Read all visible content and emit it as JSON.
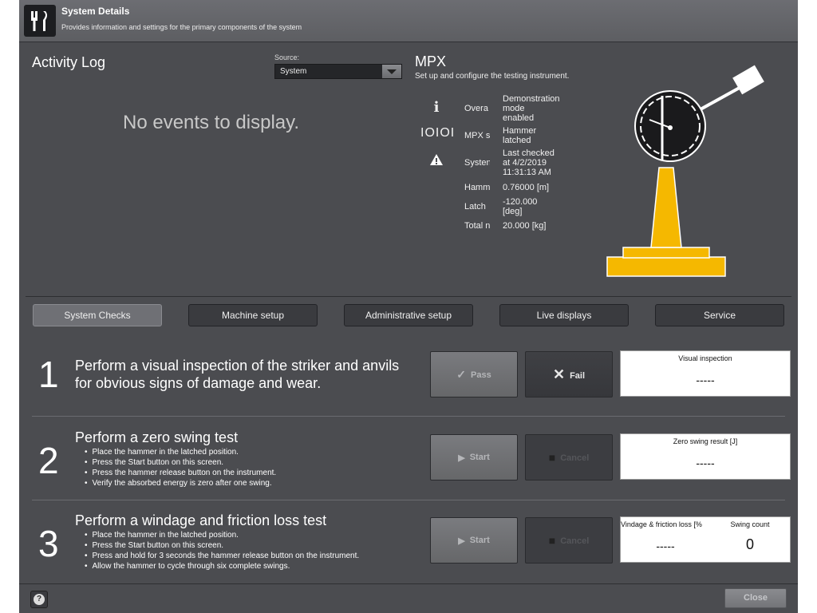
{
  "header": {
    "title": "System Details",
    "subtitle": "Provides information and settings for the primary components of the system"
  },
  "activity_log": {
    "title": "Activity Log",
    "source_label": "Source:",
    "source_value": "System",
    "empty_message": "No events to display."
  },
  "mpx": {
    "title": "MPX",
    "subtitle": "Set up and configure the testing instrument.",
    "rows": [
      {
        "label": "Overa",
        "value": "Demonstration mode enabled"
      },
      {
        "label": "MPX s",
        "value": "Hammer latched"
      },
      {
        "label": "Systen",
        "value": "Last checked at 4/2/2019 11:31:13 AM"
      },
      {
        "label": "Hamm",
        "value": "0.76000 [m]"
      },
      {
        "label": "Latch",
        "value": "-120.000 [deg]"
      },
      {
        "label": "Total n",
        "value": "20.000 [kg]"
      }
    ],
    "icons": {
      "overall": "i",
      "mpx_status": "IOIOI",
      "system": "!"
    },
    "colors": {
      "machine": "#f5b800"
    }
  },
  "tabs": [
    {
      "label": "System Checks",
      "active": true
    },
    {
      "label": "Machine setup"
    },
    {
      "label": "Administrative setup"
    },
    {
      "label": "Live displays"
    },
    {
      "label": "Service"
    }
  ],
  "steps": [
    {
      "number": "1",
      "title": "Perform a visual inspection of the striker and anvils for obvious signs of damage and wear.",
      "btn1": "Pass",
      "btn2": "Fail",
      "result_label": "Visual inspection",
      "result_value": "-----"
    },
    {
      "number": "2",
      "title": "Perform a zero swing test",
      "bullets": [
        "Place the hammer in the latched position.",
        "Press the Start button on this screen.",
        "Press the hammer release button on the instrument.",
        "Verify the absorbed energy is zero after one swing."
      ],
      "btn1": "Start",
      "btn2": "Cancel",
      "result_label": "Zero swing result [J]",
      "result_value": "-----"
    },
    {
      "number": "3",
      "title": "Perform a windage and friction loss test",
      "bullets": [
        "Place the hammer in the latched position.",
        "Press the Start button on this screen.",
        "Press and hold for 3 seconds the hammer release button on the instrument.",
        "Allow the hammer to cycle through six complete swings."
      ],
      "btn1": "Start",
      "btn2": "Cancel",
      "result_label": "Vindage & friction loss [%",
      "result_value": "-----",
      "result2_label": "Swing count",
      "result2_value": "0"
    }
  ],
  "footer": {
    "help": "?",
    "close": "Close"
  }
}
